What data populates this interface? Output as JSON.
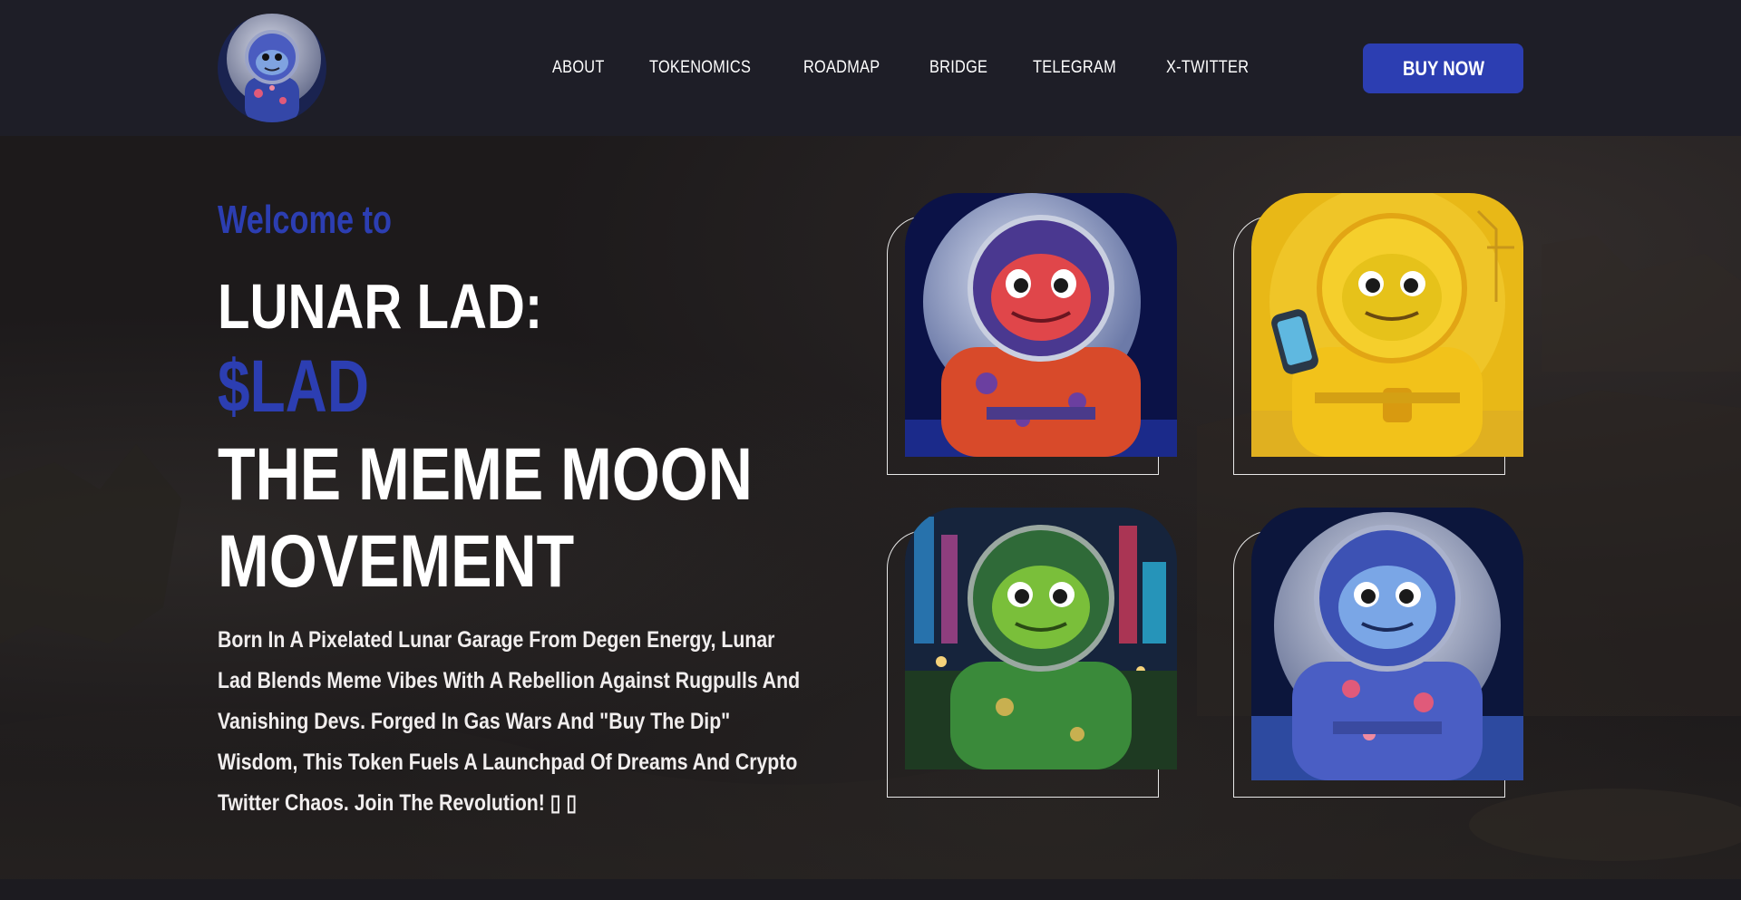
{
  "header": {
    "logo_icon": "lunar-lad-avatar-logo",
    "nav": [
      {
        "label": "ABOUT"
      },
      {
        "label": "TOKENOMICS"
      },
      {
        "label": "ROADMAP"
      },
      {
        "label": "BRIDGE"
      },
      {
        "label": "TELEGRAM"
      },
      {
        "label": "X-TWITTER"
      }
    ],
    "buy_label": "BUY NOW"
  },
  "hero": {
    "welcome": "Welcome to",
    "title_line1": "LUNAR LAD:",
    "ticker": "$LAD",
    "title_line2": "THE MEME MOON",
    "title_line3": "MOVEMENT",
    "description": "Born In A Pixelated Lunar Garage From Degen Energy, Lunar Lad Blends Meme Vibes With A Rebellion Against Rugpulls And Vanishing Devs. Forged In Gas Wars And \"Buy The Dip\" Wisdom, This Token Fuels A Launchpad Of Dreams And Crypto Twitter Chaos. Join The Revolution! ▯ ▯"
  },
  "cards": [
    {
      "name": "red-astronaut-lad",
      "suit_color": "#d94a2e"
    },
    {
      "name": "gold-astronaut-lad",
      "suit_color": "#f2c21a"
    },
    {
      "name": "green-astronaut-lad",
      "suit_color": "#3c8a3a"
    },
    {
      "name": "blue-astronaut-lad",
      "suit_color": "#4f67c9"
    }
  ],
  "colors": {
    "accent": "#2c3eb2",
    "header_bg": "#1e1e27",
    "hero_bg": "#1d1a1b"
  }
}
